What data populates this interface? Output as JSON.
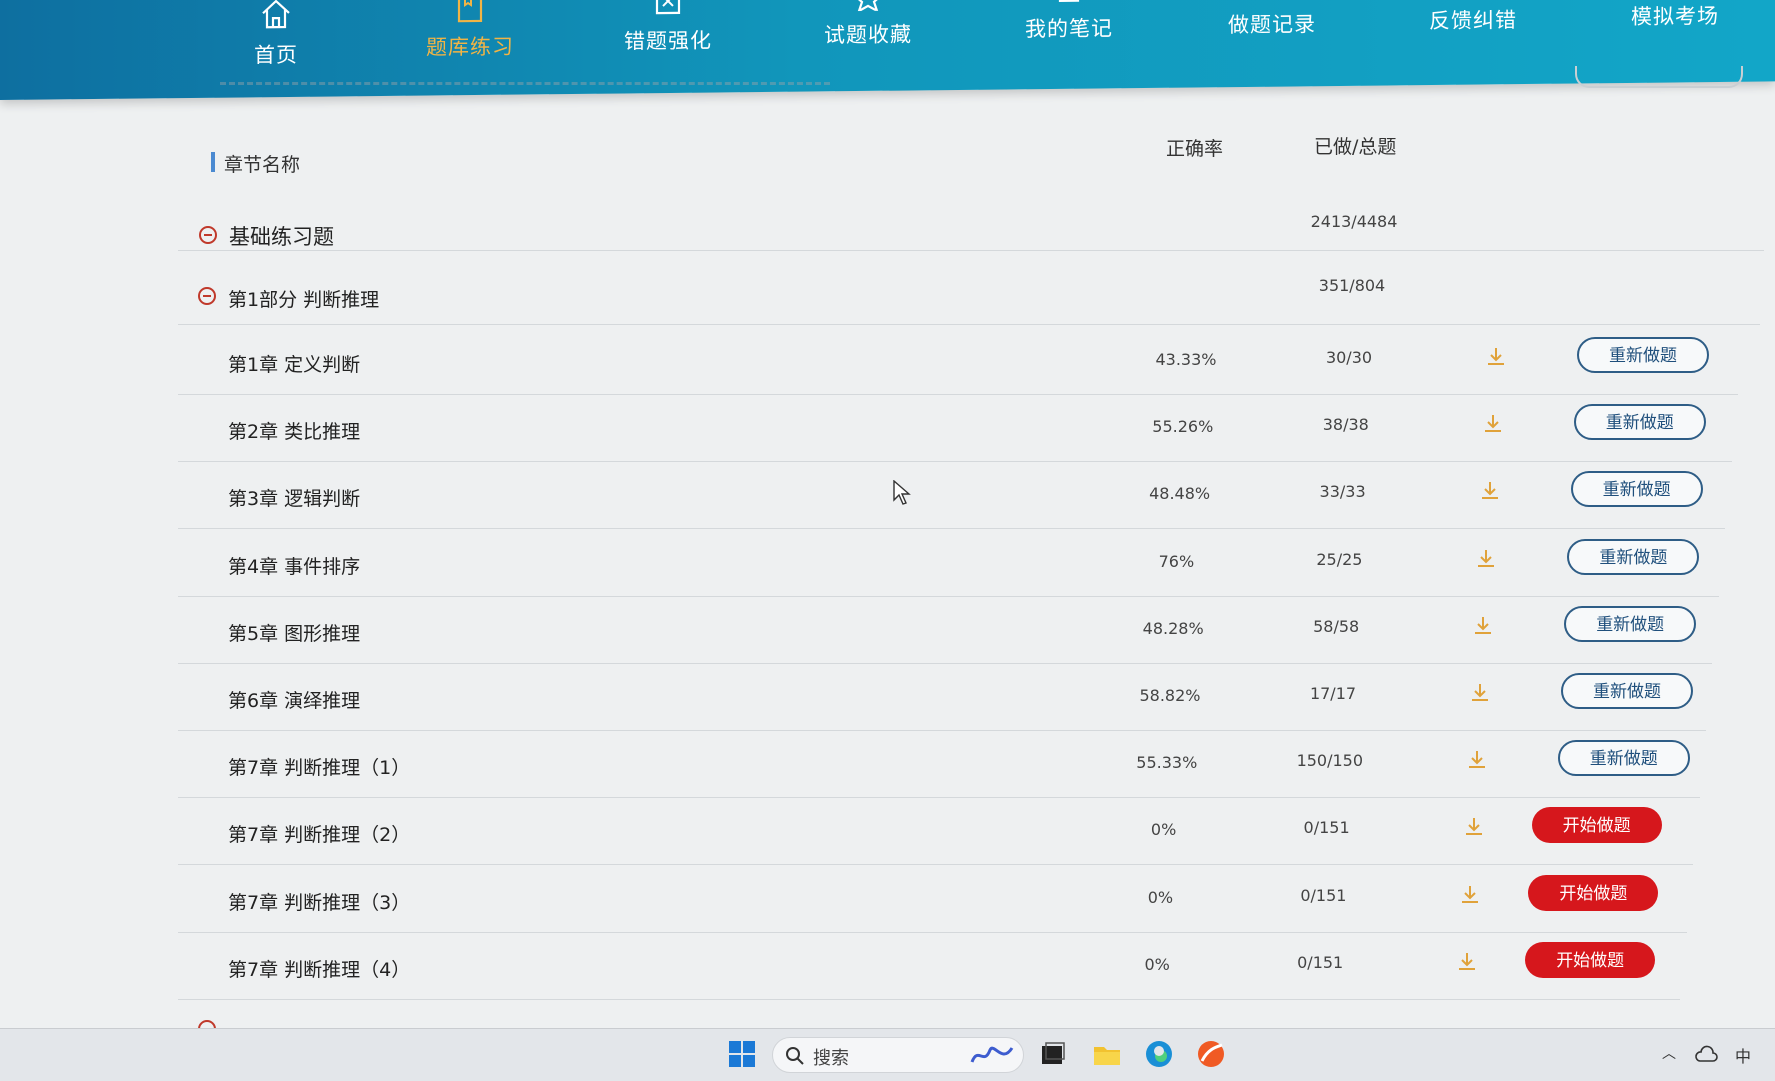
{
  "nav": {
    "items": [
      {
        "label": "首页",
        "icon": "home-icon"
      },
      {
        "label": "题库练习",
        "icon": "book-icon",
        "active": true
      },
      {
        "label": "错题强化",
        "icon": "wrong-question-icon"
      },
      {
        "label": "试题收藏",
        "icon": "star-icon"
      },
      {
        "label": "我的笔记",
        "icon": "note-icon"
      },
      {
        "label": "做题记录",
        "icon": "record-icon"
      },
      {
        "label": "反馈纠错",
        "icon": "feedback-icon"
      },
      {
        "label": "模拟考场",
        "icon": "monitor-icon"
      }
    ],
    "active_color": "#f1b445"
  },
  "table": {
    "headers": {
      "name": "章节名称",
      "rate": "正确率",
      "done_total": "已做/总题"
    },
    "section": {
      "name": "基础练习题",
      "done_total": "2413/4484"
    },
    "part": {
      "name": "第1部分 判断推理",
      "done_total": "351/804"
    },
    "rows": [
      {
        "name": "第1章 定义判断",
        "rate": "43.33%",
        "done_total": "30/30",
        "action": "重新做题"
      },
      {
        "name": "第2章 类比推理",
        "rate": "55.26%",
        "done_total": "38/38",
        "action": "重新做题"
      },
      {
        "name": "第3章 逻辑判断",
        "rate": "48.48%",
        "done_total": "33/33",
        "action": "重新做题"
      },
      {
        "name": "第4章 事件排序",
        "rate": "76%",
        "done_total": "25/25",
        "action": "重新做题"
      },
      {
        "name": "第5章 图形推理",
        "rate": "48.28%",
        "done_total": "58/58",
        "action": "重新做题"
      },
      {
        "name": "第6章 演绎推理",
        "rate": "58.82%",
        "done_total": "17/17",
        "action": "重新做题"
      },
      {
        "name": "第7章 判断推理（1）",
        "rate": "55.33%",
        "done_total": "150/150",
        "action": "重新做题"
      },
      {
        "name": "第7章 判断推理（2）",
        "rate": "0%",
        "done_total": "0/151",
        "action": "开始做题"
      },
      {
        "name": "第7章 判断推理（3）",
        "rate": "0%",
        "done_total": "0/151",
        "action": "开始做题"
      },
      {
        "name": "第7章 判断推理（4）",
        "rate": "0%",
        "done_total": "0/151",
        "action": "开始做题"
      }
    ],
    "colors": {
      "redo_border": "#2e5d86",
      "start_bg": "#d6171c",
      "collapse": "#c0392b",
      "download": "#e0a23a"
    }
  },
  "taskbar": {
    "search_placeholder": "搜索",
    "ime_label": "中",
    "apps": [
      "windows-start-icon",
      "search-icon",
      "task-view-icon",
      "file-explorer-icon",
      "edge-browser-icon",
      "app-icon"
    ]
  }
}
